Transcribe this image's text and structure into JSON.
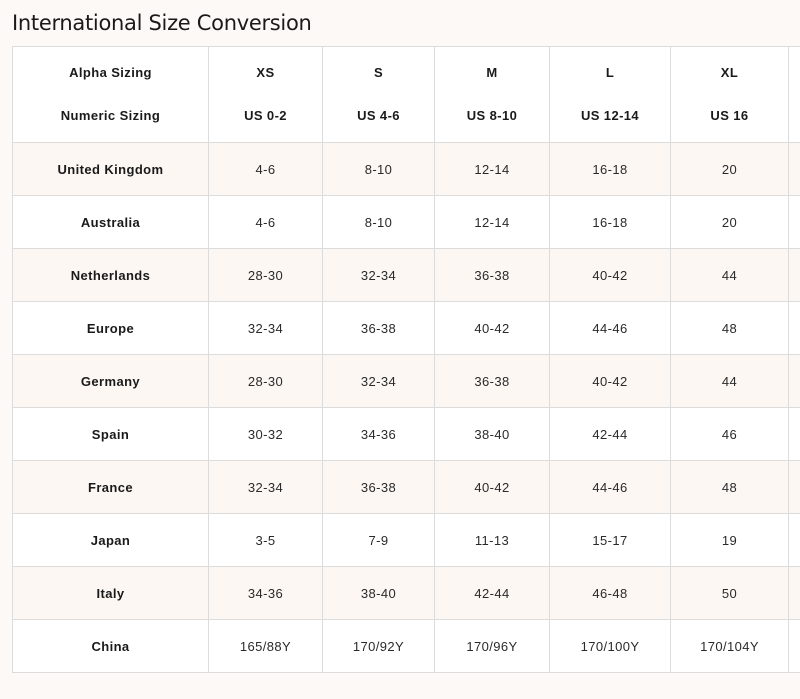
{
  "page": {
    "title": "International Size Conversion"
  },
  "table": {
    "header": {
      "alpha_label": "Alpha Sizing",
      "numeric_label": "Numeric Sizing",
      "columns": [
        {
          "alpha": "XS",
          "numeric": "US 0-2"
        },
        {
          "alpha": "S",
          "numeric": "US 4-6"
        },
        {
          "alpha": "M",
          "numeric": "US 8-10"
        },
        {
          "alpha": "L",
          "numeric": "US 12-14"
        },
        {
          "alpha": "XL",
          "numeric": "US 16"
        }
      ]
    },
    "rows": [
      {
        "country": "United Kingdom",
        "values": [
          "4-6",
          "8-10",
          "12-14",
          "16-18",
          "20"
        ]
      },
      {
        "country": "Australia",
        "values": [
          "4-6",
          "8-10",
          "12-14",
          "16-18",
          "20"
        ]
      },
      {
        "country": "Netherlands",
        "values": [
          "28-30",
          "32-34",
          "36-38",
          "40-42",
          "44"
        ]
      },
      {
        "country": "Europe",
        "values": [
          "32-34",
          "36-38",
          "40-42",
          "44-46",
          "48"
        ]
      },
      {
        "country": "Germany",
        "values": [
          "28-30",
          "32-34",
          "36-38",
          "40-42",
          "44"
        ]
      },
      {
        "country": "Spain",
        "values": [
          "30-32",
          "34-36",
          "38-40",
          "42-44",
          "46"
        ]
      },
      {
        "country": "France",
        "values": [
          "32-34",
          "36-38",
          "40-42",
          "44-46",
          "48"
        ]
      },
      {
        "country": "Japan",
        "values": [
          "3-5",
          "7-9",
          "11-13",
          "15-17",
          "19"
        ]
      },
      {
        "country": "Italy",
        "values": [
          "34-36",
          "38-40",
          "42-44",
          "46-48",
          "50"
        ]
      },
      {
        "country": "China",
        "values": [
          "165/88Y",
          "170/92Y",
          "170/96Y",
          "170/100Y",
          "170/104Y"
        ]
      }
    ]
  }
}
